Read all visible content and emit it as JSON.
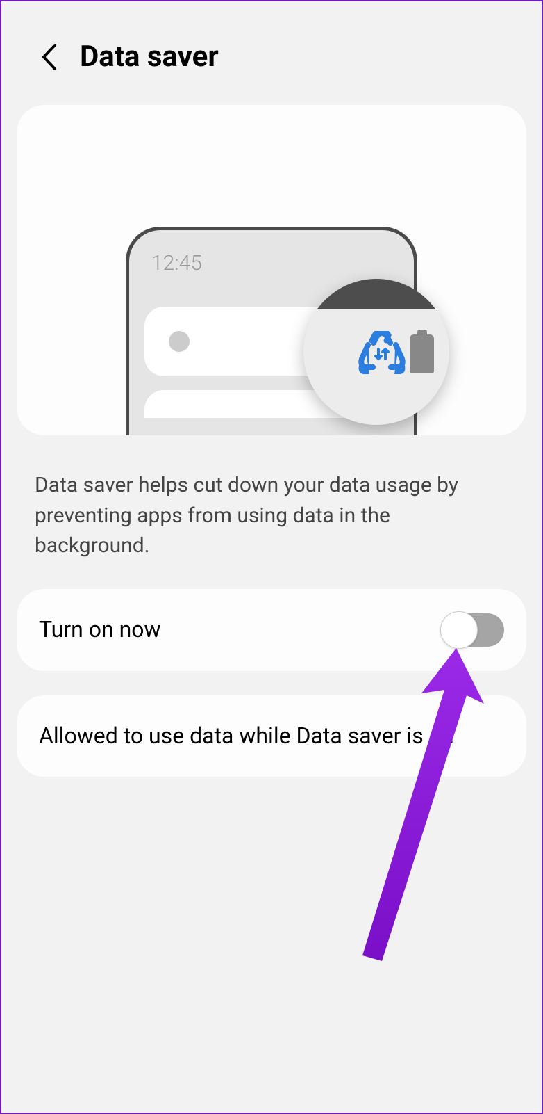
{
  "header": {
    "title": "Data saver"
  },
  "illustration": {
    "time": "12:45"
  },
  "description": "Data saver helps cut down your data usage by preventing apps from using data in the background.",
  "settings": {
    "turnOn": {
      "label": "Turn on now",
      "state": false
    },
    "allowed": {
      "label": "Allowed to use data while Data saver is on"
    }
  },
  "colors": {
    "accent": "#2b7ee0",
    "annotation": "#8a17d8"
  }
}
